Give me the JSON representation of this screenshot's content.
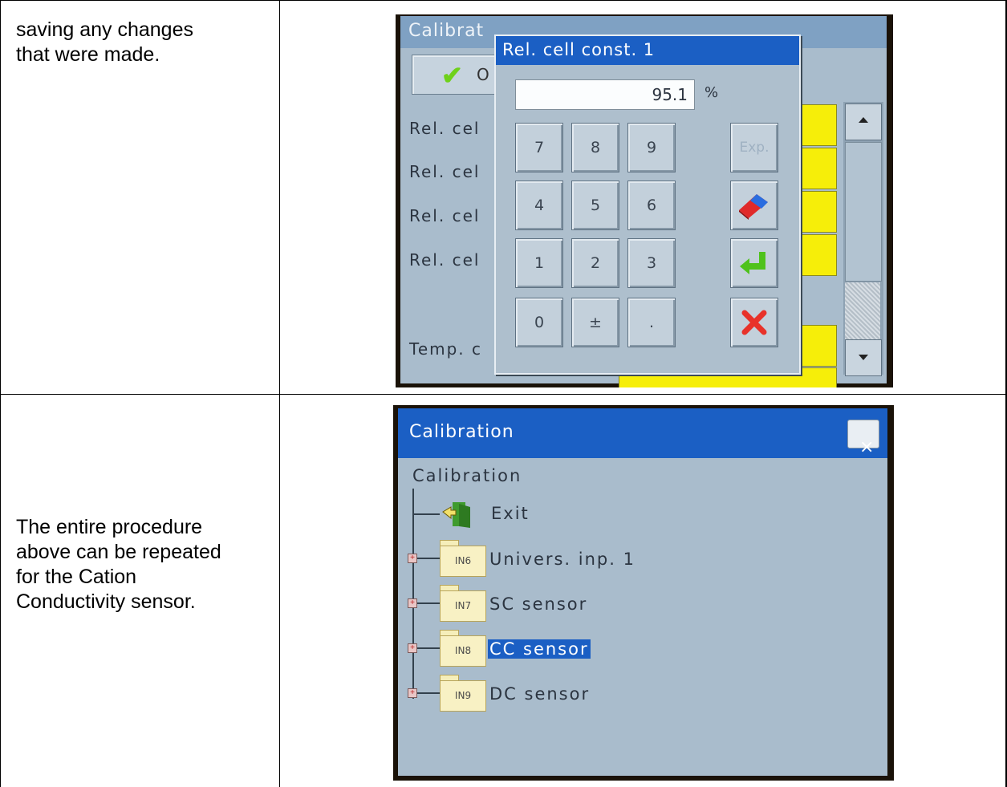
{
  "rows": [
    {
      "description_lines": [
        "saving any changes",
        "that were made."
      ],
      "screen": {
        "window_title": "Calibrat",
        "ok_button_label": "O",
        "list_rows": [
          "Rel. cel",
          "Rel. cel",
          "Rel. cel",
          "Rel. cel",
          "Temp. c"
        ],
        "dialog": {
          "title": "Rel. cell const. 1",
          "value": "95.1",
          "unit": "%",
          "keys": [
            "7",
            "8",
            "9",
            "4",
            "5",
            "6",
            "1",
            "2",
            "3",
            "0",
            "±",
            "."
          ],
          "exp_label": "Exp."
        },
        "colors": {
          "title_bar": "#1b5fc4",
          "field_yellow": "#f6ee09",
          "panel": "#a9bccc"
        }
      }
    },
    {
      "description_lines": [
        "The entire procedure",
        "above can be repeated",
        "for the Cation",
        "Conductivity sensor."
      ],
      "screen": {
        "window_title": "Calibration",
        "close_label": "×",
        "tree_root": "Calibration",
        "exit_label": "Exit",
        "nodes": [
          {
            "folder": "IN6",
            "label": "Univers. inp. 1"
          },
          {
            "folder": "IN7",
            "label": "SC sensor"
          },
          {
            "folder": "IN8",
            "label": "CC sensor",
            "selected": true
          },
          {
            "folder": "IN9",
            "label": "DC sensor"
          }
        ]
      }
    }
  ]
}
